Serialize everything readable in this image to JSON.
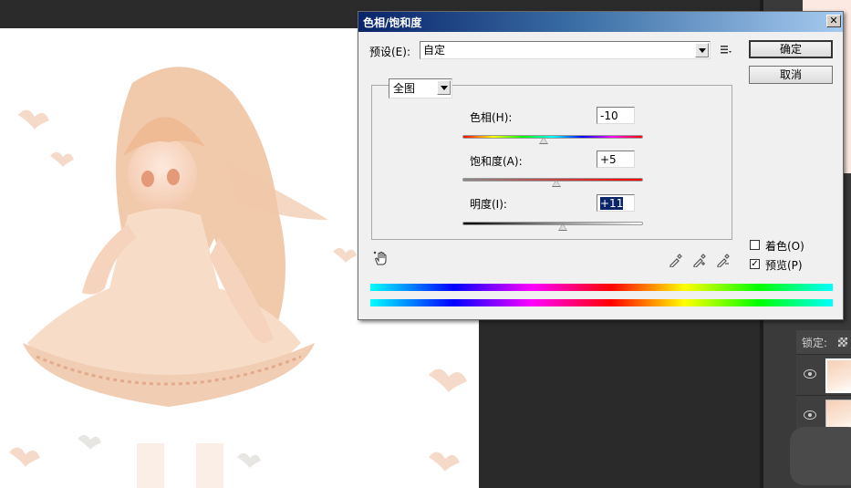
{
  "dialog": {
    "title": "色相/饱和度",
    "close_glyph": "✕",
    "preset_label": "预设(E):",
    "preset_value": "自定",
    "ok_label": "确定",
    "cancel_label": "取消",
    "channel_value": "全图",
    "hue": {
      "label": "色相(H):",
      "value": "-10",
      "level": 0.45
    },
    "saturation": {
      "label": "饱和度(A):",
      "value": "+5",
      "level": 0.52
    },
    "lightness": {
      "label": "明度(I):",
      "value": "+11",
      "level": 0.555
    },
    "colorize": {
      "label": "着色(O)",
      "checked": false
    },
    "preview": {
      "label": "预览(P)",
      "checked": true,
      "check_glyph": "✓"
    }
  },
  "icons": {
    "preset_menu": "list-menu-icon",
    "hand": "hand-adjust-icon",
    "eyedroppers": [
      "eyedropper-icon",
      "eyedropper-plus-icon",
      "eyedropper-minus-icon"
    ]
  },
  "layers_panel": {
    "lock_label": "锁定:"
  }
}
